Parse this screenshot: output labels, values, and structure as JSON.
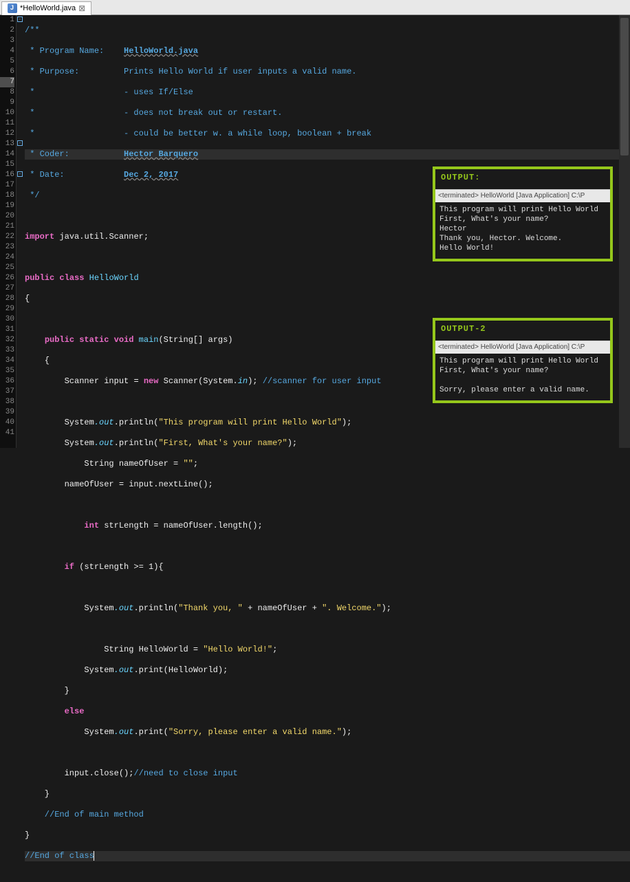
{
  "tab": {
    "label": "*HelloWorld.java",
    "close": "⊠"
  },
  "lines": [
    "1",
    "2",
    "3",
    "4",
    "5",
    "6",
    "7",
    "8",
    "9",
    "10",
    "11",
    "12",
    "13",
    "14",
    "15",
    "16",
    "17",
    "18",
    "19",
    "20",
    "21",
    "22",
    "23",
    "24",
    "25",
    "26",
    "27",
    "28",
    "29",
    "30",
    "31",
    "32",
    "33",
    "34",
    "35",
    "36",
    "37",
    "38",
    "39",
    "40",
    "41"
  ],
  "code": {
    "l1": "/**",
    "l2a": " * Program Name:    ",
    "l2b": "HelloWorld.java",
    "l3a": " * Purpose:         ",
    "l3b": "Prints Hello World if user inputs a valid name.",
    "l4": " *                  - uses If/Else",
    "l5": " *                  - does not break out or restart.",
    "l6": " *                  - could be better w. a while loop, boolean + break",
    "l7a": " * Coder:           ",
    "l7b": "Hector Barquero",
    "l8a": " * Date:            ",
    "l8b": "Dec 2, 2017",
    "l9": " */",
    "l11_imp": "import",
    "l11_pkg": " java",
    "l11_d1": ".",
    "l11_util": "util",
    "l11_d2": ".",
    "l11_scan": "Scanner",
    "l11_semi": ";",
    "l13_pub": "public",
    "l13_cls": " class",
    "l13_name": " HelloWorld",
    "l14": "{",
    "l16_indent": "    ",
    "l16_pub": "public",
    "l16_stat": " static",
    "l16_void": " void",
    "l16_main": " main",
    "l16_par": "(String[] args)",
    "l17": "    {",
    "l18_i": "        ",
    "l18_scan": "Scanner",
    "l18_in": " input ",
    "l18_eq": "=",
    "l18_new": " new",
    "l18_sc2": " Scanner",
    "l18_p": "(System.",
    "l18_inf": "in",
    "l18_e": "); ",
    "l18_c": "//scanner for user input",
    "l20_i": "        System",
    "l20_o": ".out",
    "l20_m": ".println",
    "l20_p": "(",
    "l20_s": "\"This program will print Hello World\"",
    "l20_e": ");",
    "l21_i": "        System",
    "l21_o": ".out",
    "l21_m": ".println",
    "l21_p": "(",
    "l21_s": "\"First, What's your name?\"",
    "l21_e": ");",
    "l22_i": "            String nameOfUser ",
    "l22_eq": "=",
    "l22_s": " \"\"",
    "l22_e": ";",
    "l23_i": "        nameOfUser ",
    "l23_eq": "=",
    "l23_in": " input",
    "l23_m": ".nextLine",
    "l23_e": "();",
    "l25_i": "            ",
    "l25_int": "int",
    "l25_v": " strLength ",
    "l25_eq": "=",
    "l25_n": " nameOfUser",
    "l25_m": ".length",
    "l25_e": "();",
    "l27_i": "        ",
    "l27_if": "if",
    "l27_c": " (strLength >= 1){",
    "l29_i": "            System",
    "l29_o": ".out",
    "l29_m": ".println",
    "l29_p": "(",
    "l29_s1": "\"Thank you, \"",
    "l29_pl": " + nameOfUser + ",
    "l29_s2": "\". Welcome.\"",
    "l29_e": ");",
    "l31_i": "                String HelloWorld ",
    "l31_eq": "=",
    "l31_s": " \"Hello World!\"",
    "l31_e": ";",
    "l32_i": "            System",
    "l32_o": ".out",
    "l32_m": ".print",
    "l32_p": "(HelloWorld);",
    "l33": "        }",
    "l34_i": "        ",
    "l34_e": "else",
    "l35_i": "            System",
    "l35_o": ".out",
    "l35_m": ".print",
    "l35_p": "(",
    "l35_s": "\"Sorry, please enter a valid name.\"",
    "l35_e": ");",
    "l37_i": "        input",
    "l37_m": ".close",
    "l37_p": "();",
    "l37_c": "//need to close input",
    "l38": "    }",
    "l39": "    //End of main method",
    "l40": "}",
    "l41": "//End of class"
  },
  "output1": {
    "title": "OUTPUT:",
    "term": "<terminated> HelloWorld [Java Application] C:\\P",
    "lines": [
      "This program will print Hello World",
      "First, What's your name?",
      "Hector",
      "Thank you, Hector. Welcome.",
      "Hello World!"
    ]
  },
  "output2": {
    "title": "OUTPUT-2",
    "term": "<terminated> HelloWorld [Java Application] C:\\P",
    "lines": [
      "This program will print Hello World",
      "First, What's your name?",
      "",
      "Sorry, please enter a valid name."
    ]
  }
}
